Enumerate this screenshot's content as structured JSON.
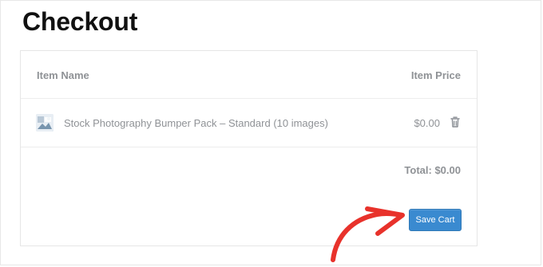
{
  "page": {
    "title": "Checkout"
  },
  "cart": {
    "columns": {
      "item_name": "Item Name",
      "item_price": "Item Price"
    },
    "items": [
      {
        "name": "Stock Photography Bumper Pack – Standard (10 images)",
        "price": "$0.00",
        "remove_icon": "trash-icon"
      }
    ],
    "total_label": "Total:",
    "total_value": "$0.00",
    "save_label": "Save Cart"
  },
  "colors": {
    "title": "#111111",
    "muted_text": "#8f9296",
    "border": "#e6e6e6",
    "button": "#3a8ad0",
    "annotation_arrow": "#e8322b"
  }
}
